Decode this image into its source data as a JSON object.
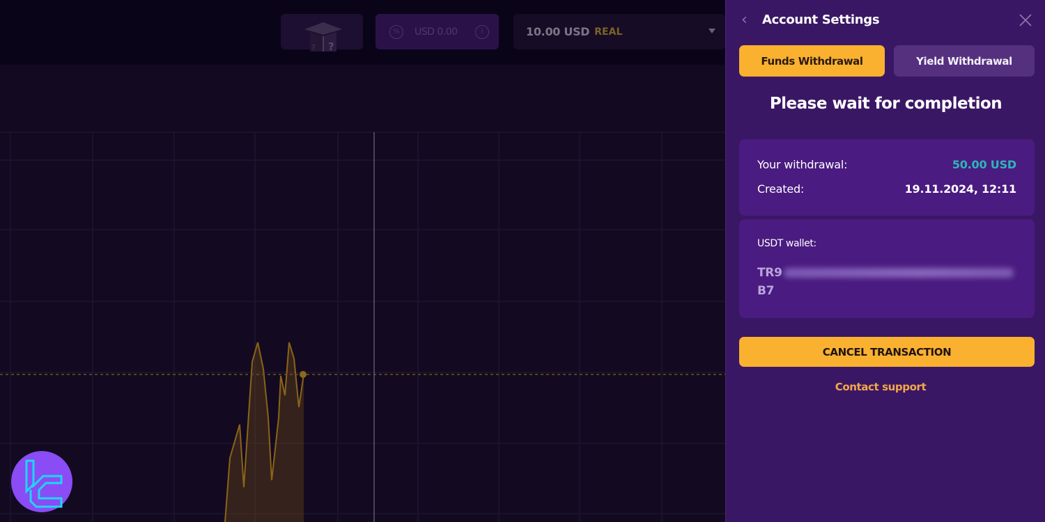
{
  "topbar": {
    "mystery_box_icon": "mystery-box-icon",
    "bonus": {
      "icon": "timer-percent-icon",
      "value": "USD 0.00",
      "info_icon": "info-icon"
    },
    "balance": {
      "amount": "10.00 USD",
      "account_type": "REAL",
      "dropdown_icon": "caret-down-icon"
    }
  },
  "chart": {
    "price_line_color": "#c8951f",
    "current_price_marker": "dashed-line",
    "colors": {
      "background": "#130a21",
      "grid": "#1e1430",
      "vertical_marker": "#6b6478"
    }
  },
  "panel": {
    "back_icon": "chevron-left-icon",
    "title": "Account Settings",
    "close_icon": "close-icon",
    "tabs": [
      {
        "label": "Funds Withdrawal",
        "active": true
      },
      {
        "label": "Yield Withdrawal",
        "active": false
      }
    ],
    "status_heading": "Please wait for completion",
    "details": {
      "withdrawal_label": "Your withdrawal:",
      "withdrawal_value": "50.00 USD",
      "created_label": "Created:",
      "created_value": "19.11.2024, 12:11"
    },
    "wallet": {
      "label": "USDT wallet:",
      "address_start": "TR9",
      "address_end": "B7"
    },
    "cancel_button": "CANCEL TRANSACTION",
    "support_link": "Contact support",
    "colors": {
      "accent": "#fbb130",
      "panel_bg": "#3a1764",
      "card_bg": "#4a1b80",
      "amount": "#2fb5b8",
      "link": "#f4a64a"
    }
  },
  "watermark": {
    "logo": "tc-logo-icon"
  }
}
